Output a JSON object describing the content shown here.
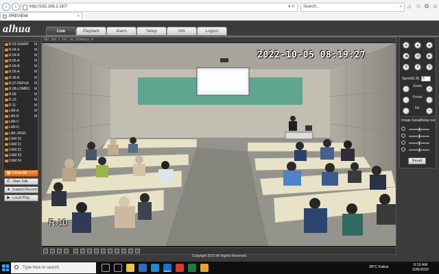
{
  "browser": {
    "url": "http://192.168.2.167/",
    "search_placeholder": "Search...",
    "tab_title": "PREVIEW"
  },
  "app": {
    "logo": "alhua",
    "menu": [
      {
        "label": "Live",
        "active": true
      },
      {
        "label": "Playback",
        "active": false
      },
      {
        "label": "Alarm",
        "active": false
      },
      {
        "label": "Setup",
        "active": false
      },
      {
        "label": "Info",
        "active": false
      },
      {
        "label": "Logout",
        "active": false
      }
    ],
    "cameras": [
      {
        "label": "R.03-SUMAT",
        "flag": "M"
      },
      {
        "label": "R.04-A",
        "flag": "M"
      },
      {
        "label": "R.04-B",
        "flag": "M"
      },
      {
        "label": "R.05-A",
        "flag": "M"
      },
      {
        "label": "R.05-B",
        "flag": "M"
      },
      {
        "label": "R.06-A",
        "flag": "M"
      },
      {
        "label": "R.06-B",
        "flag": "M"
      },
      {
        "label": "R.07-PAPUA",
        "flag": "M"
      },
      {
        "label": "R.08-LOMBO",
        "flag": "M"
      },
      {
        "label": "R.09",
        "flag": "M"
      },
      {
        "label": "R.10",
        "flag": "M"
      },
      {
        "label": "R.11",
        "flag": "M"
      },
      {
        "label": "LAB-A",
        "flag": "M"
      },
      {
        "label": "LAB-B",
        "flag": "M"
      },
      {
        "label": "LAB-C",
        "flag": ""
      },
      {
        "label": "LAB-D",
        "flag": ""
      },
      {
        "label": "LAB-JRGN",
        "flag": ""
      },
      {
        "label": "CAM 20",
        "flag": ""
      },
      {
        "label": "CAM 21",
        "flag": ""
      },
      {
        "label": "CAM 22",
        "flag": ""
      },
      {
        "label": "CAM 23",
        "flag": ""
      },
      {
        "label": "CAM 24",
        "flag": ""
      }
    ],
    "actions": {
      "close_all": "Close All",
      "start_talk": "Start Talk",
      "instant_record": "Instant Record",
      "local_play": "Local Play"
    },
    "video": {
      "header": "192.168.2.167_10_1920kbps_R",
      "timestamp": "2022-10-05 08:19:27",
      "room_label": "R.10"
    },
    "ptz": {
      "speed_label": "Speed(1-8)",
      "speed_value": "5",
      "zoom_label": "Zoom",
      "focus_label": "Focus",
      "iris_label": "Iris"
    },
    "image_setup": {
      "tab_image": "Image Setup",
      "tab_relay": "Relay-out",
      "brightness": 0.5,
      "contrast": 0.5,
      "saturation": 0.5,
      "hue": 0.5,
      "reset_label": "Reset"
    },
    "copyright": "Copyright 2015 All Rights Reserved."
  },
  "taskbar": {
    "search_placeholder": "Type here to search",
    "weather": "28°C  Kabut",
    "time": "8:19 AM",
    "date": "10/5/2022"
  }
}
